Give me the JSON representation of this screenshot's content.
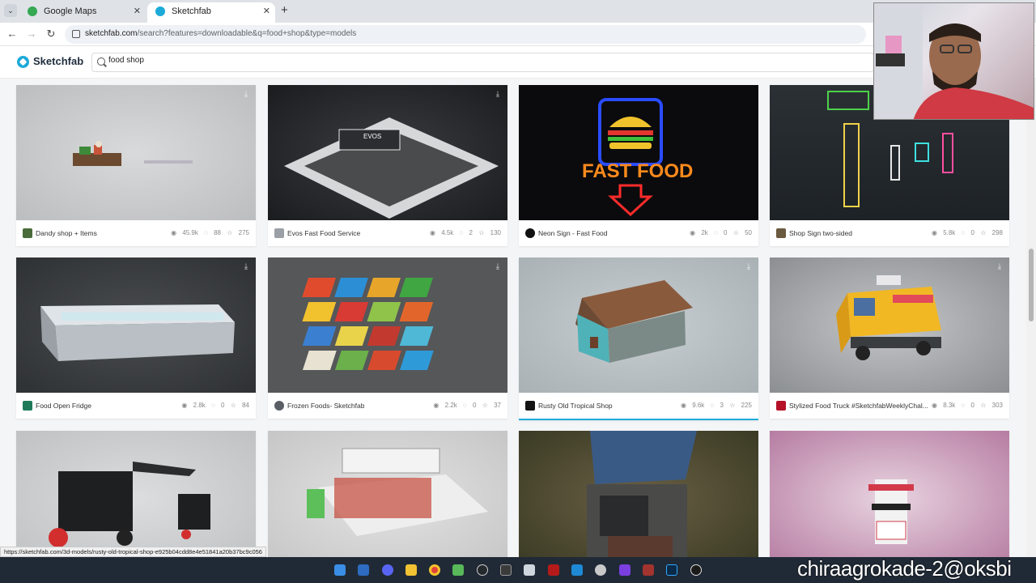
{
  "browser": {
    "tabs": [
      {
        "title": "Google Maps",
        "icon": "google-maps-icon",
        "active": false
      },
      {
        "title": "Sketchfab",
        "icon": "sketchfab-icon",
        "active": true
      }
    ],
    "url_main": "sketchfab.com",
    "url_rest": "/search?features=downloadable&q=food+shop&type=models"
  },
  "site": {
    "brand": "Sketchfab",
    "search_value": "food shop"
  },
  "models": [
    {
      "title": "Dandy shop + Items",
      "views": "45.9k",
      "comments": "88",
      "likes": "275"
    },
    {
      "title": "Evos Fast Food Service",
      "views": "4.5k",
      "comments": "2",
      "likes": "130"
    },
    {
      "title": "Neon Sign - Fast Food",
      "views": "2k",
      "comments": "0",
      "likes": "50"
    },
    {
      "title": "Shop Sign two-sided",
      "views": "5.8k",
      "comments": "0",
      "likes": "298"
    },
    {
      "title": "Food Open Fridge",
      "views": "2.8k",
      "comments": "0",
      "likes": "84"
    },
    {
      "title": "Frozen Foods- Sketchfab",
      "views": "2.2k",
      "comments": "0",
      "likes": "37"
    },
    {
      "title": "Rusty Old Tropical Shop",
      "views": "9.6k",
      "comments": "3",
      "likes": "225"
    },
    {
      "title": "Stylized Food Truck #SketchfabWeeklyChal...",
      "views": "8.3k",
      "comments": "0",
      "likes": "303"
    }
  ],
  "thumb_texts": {
    "fast_food": "FAST FOOD",
    "evos": "EVOS"
  },
  "status_link": "https://sketchfab.com/3d-models/rusty-old-tropical-shop-e925b04cdd8e4e51841a20b37bc9c056",
  "watermark": "chiraagrokade-2@oksbi"
}
